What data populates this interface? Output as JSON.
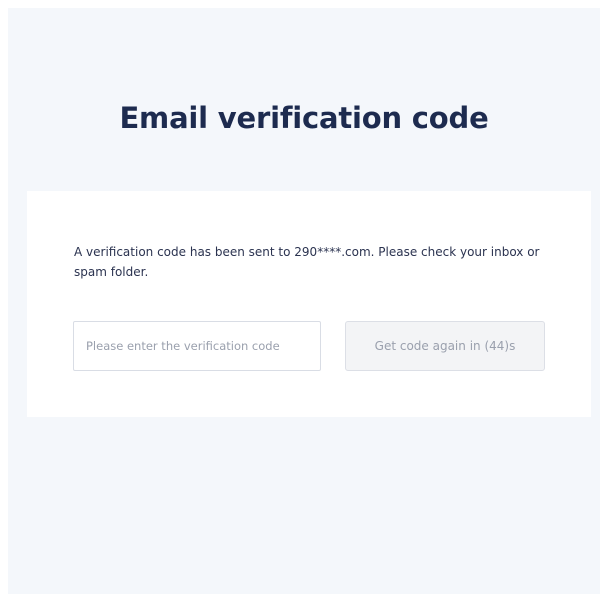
{
  "page": {
    "title": "Email verification code"
  },
  "card": {
    "message": "A verification code has been sent to 290****.com. Please check your inbox or spam folder.",
    "code_input": {
      "value": "",
      "placeholder": "Please enter the verification code"
    },
    "resend_button": {
      "label": "Get code again in (44)s",
      "disabled": true
    }
  },
  "colors": {
    "page_background": "#f4f7fb",
    "card_background": "#ffffff",
    "title_text": "#1d2b4f",
    "body_text": "#2b3350",
    "muted_text": "#9aa0ad",
    "button_background": "#f3f4f6"
  }
}
